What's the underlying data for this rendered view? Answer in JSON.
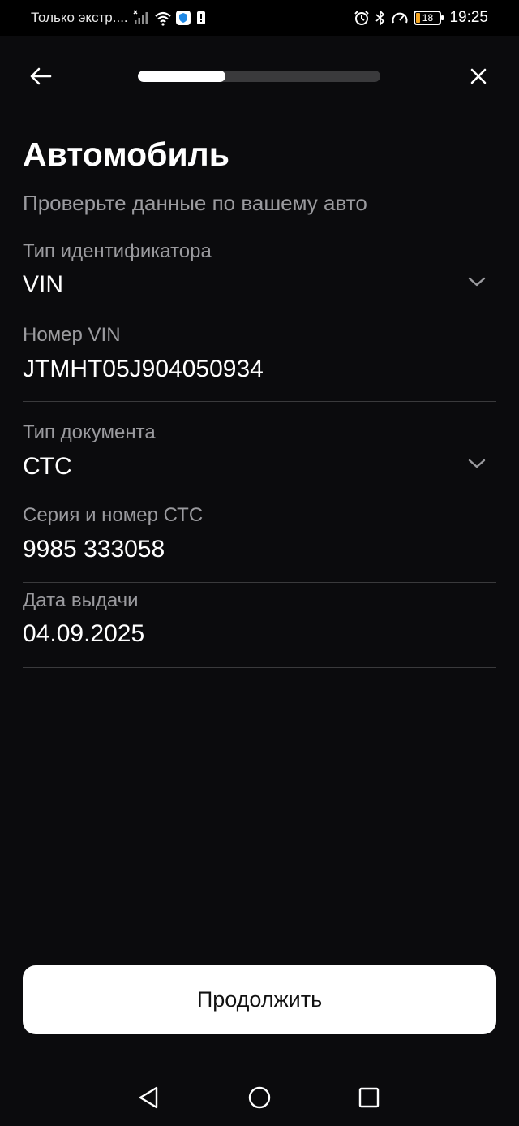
{
  "status_bar": {
    "carrier": "Только экстр....",
    "time": "19:25",
    "battery_level": "18",
    "icons": [
      "signal-icon",
      "wifi-icon",
      "shield-icon",
      "alert-icon",
      "alarm-icon",
      "bluetooth-icon",
      "speed-icon"
    ]
  },
  "header": {
    "progress_fraction": 0.36,
    "back_icon": "arrow-left-icon",
    "close_icon": "close-icon"
  },
  "page": {
    "title": "Автомобиль",
    "subtitle": "Проверьте данные по вашему авто"
  },
  "fields": [
    {
      "label": "Тип идентификатора",
      "value": "VIN",
      "dropdown": true
    },
    {
      "label": "Номер VIN",
      "value": "JTMHT05J904050934",
      "dropdown": false
    },
    {
      "label": "Тип документа",
      "value": "СТС",
      "dropdown": true
    },
    {
      "label": "Серия и номер СТС",
      "value": "9985 333058",
      "dropdown": false
    },
    {
      "label": "Дата выдачи",
      "value": "04.09.2025",
      "dropdown": false
    }
  ],
  "actions": {
    "continue_label": "Продолжить"
  },
  "colors": {
    "background": "#0b0b0d",
    "secondary_text": "#9b9b9f",
    "divider": "#3a3a3c",
    "button_bg": "#ffffff",
    "battery_accent": "#f5a623"
  }
}
